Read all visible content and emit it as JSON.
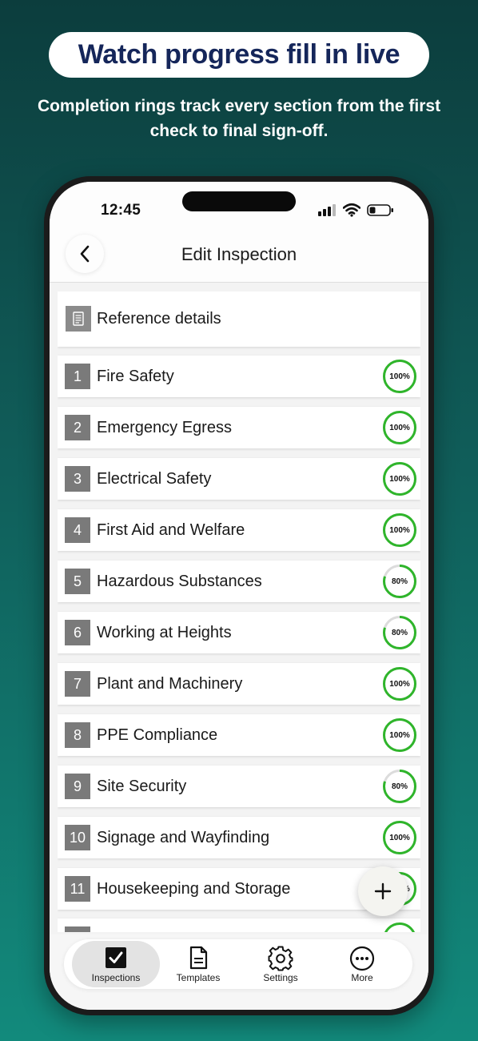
{
  "promo": {
    "headline": "Watch progress fill in live",
    "subheadline": "Completion rings track every section from the first check to final sign-off."
  },
  "status_bar": {
    "time": "12:45"
  },
  "nav": {
    "title": "Edit Inspection",
    "back_icon": "chevron-left-icon"
  },
  "reference": {
    "label": "Reference details",
    "icon": "document-icon"
  },
  "sections": [
    {
      "number": "1",
      "label": "Fire Safety",
      "progress": 100,
      "progress_label": "100%"
    },
    {
      "number": "2",
      "label": "Emergency Egress",
      "progress": 100,
      "progress_label": "100%"
    },
    {
      "number": "3",
      "label": "Electrical Safety",
      "progress": 100,
      "progress_label": "100%"
    },
    {
      "number": "4",
      "label": "First Aid and Welfare",
      "progress": 100,
      "progress_label": "100%"
    },
    {
      "number": "5",
      "label": "Hazardous Substances",
      "progress": 80,
      "progress_label": "80%"
    },
    {
      "number": "6",
      "label": "Working at Heights",
      "progress": 80,
      "progress_label": "80%"
    },
    {
      "number": "7",
      "label": "Plant and Machinery",
      "progress": 100,
      "progress_label": "100%"
    },
    {
      "number": "8",
      "label": "PPE Compliance",
      "progress": 100,
      "progress_label": "100%"
    },
    {
      "number": "9",
      "label": "Site Security",
      "progress": 80,
      "progress_label": "80%"
    },
    {
      "number": "10",
      "label": "Signage and Wayfinding",
      "progress": 100,
      "progress_label": "100%"
    },
    {
      "number": "11",
      "label": "Housekeeping and Storage",
      "progress": 100,
      "progress_label": "100%"
    }
  ],
  "fab": {
    "icon": "plus-icon"
  },
  "tabs": [
    {
      "label": "Inspections",
      "icon": "checkbox-icon",
      "active": true
    },
    {
      "label": "Templates",
      "icon": "document-icon",
      "active": false
    },
    {
      "label": "Settings",
      "icon": "gear-icon",
      "active": false
    },
    {
      "label": "More",
      "icon": "more-icon",
      "active": false
    }
  ],
  "colors": {
    "progress_ring": "#2fb52b",
    "progress_track": "#dcdcdc",
    "headline_text": "#15265a",
    "number_badge": "#7a7a7a"
  }
}
